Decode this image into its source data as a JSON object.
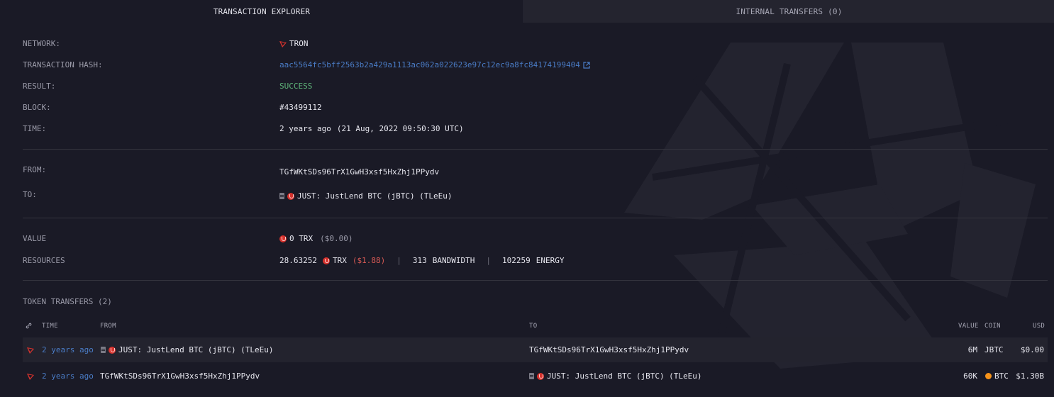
{
  "tabs": {
    "explorer": "TRANSACTION EXPLORER",
    "internal": "INTERNAL TRANSFERS (0)"
  },
  "details": {
    "network_label": "NETWORK:",
    "network_value": "TRON",
    "hash_label": "TRANSACTION HASH:",
    "hash_value": "aac5564fc5bff2563b2a429a1113ac062a022623e97c12ec9a8fc84174199404",
    "result_label": "RESULT:",
    "result_value": "SUCCESS",
    "block_label": "BLOCK:",
    "block_value": "#43499112",
    "time_label": "TIME:",
    "time_relative": "2 years ago",
    "time_absolute": "(21 Aug, 2022 09:50:30 UTC)",
    "from_label": "FROM:",
    "from_value": "TGfWKtSDs96TrX1GwH3xsf5HxZhj1PPydv",
    "to_label": "TO:",
    "to_value": "JUST: JustLend BTC (jBTC) (TLeEu)",
    "value_label": "VALUE",
    "value_amount": "0 TRX",
    "value_usd": "($0.00)",
    "resources_label": "RESOURCES",
    "res_trx_amount": "28.63252",
    "res_trx_unit": "TRX",
    "res_trx_usd": "($1.88)",
    "res_bandwidth_amount": "313",
    "res_bandwidth_unit": "BANDWIDTH",
    "res_energy_amount": "102259",
    "res_energy_unit": "ENERGY",
    "separator": "|"
  },
  "token_transfers": {
    "title": "TOKEN TRANSFERS (2)",
    "headers": {
      "time": "TIME",
      "from": "FROM",
      "to": "TO",
      "value": "VALUE",
      "coin": "COIN",
      "usd": "USD"
    },
    "rows": [
      {
        "time": "2 years ago",
        "from": "JUST: JustLend BTC (jBTC) (TLeEu)",
        "to": "TGfWKtSDs96TrX1GwH3xsf5HxZhj1PPydv",
        "value": "6M",
        "coin": "JBTC",
        "usd": "$0.00"
      },
      {
        "time": "2 years ago",
        "from": "TGfWKtSDs96TrX1GwH3xsf5HxZhj1PPydv",
        "to": "JUST: JustLend BTC (jBTC) (TLeEu)",
        "value": "60K",
        "coin": "BTC",
        "usd": "$1.30B"
      }
    ]
  },
  "colors": {
    "background": "#1a1a26",
    "accent_link": "#4a7cc6",
    "success": "#5fb57a",
    "tron_red": "#d6322d"
  },
  "icons": [
    "tron-icon",
    "external-link-icon",
    "contract-icon",
    "just-token-icon",
    "trx-coin-icon",
    "link-icon",
    "btc-coin-icon"
  ]
}
